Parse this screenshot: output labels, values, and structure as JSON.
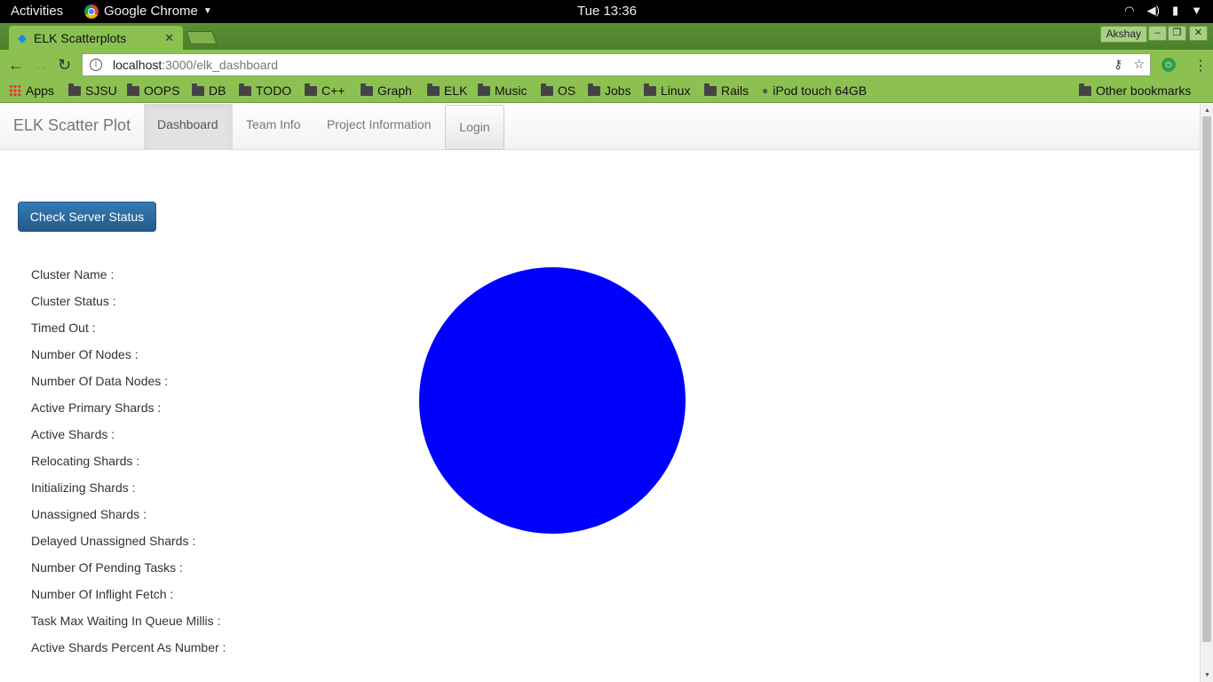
{
  "os_bar": {
    "activities": "Activities",
    "app_name": "Google Chrome",
    "clock": "Tue 13:36"
  },
  "browser": {
    "tab_title": "ELK Scatterplots",
    "user_name": "Akshay",
    "url_host": "localhost",
    "url_path": ":3000/elk_dashboard",
    "bookmarks": [
      "Apps",
      "SJSU",
      "OOPS",
      "DB",
      "TODO",
      "C++",
      "Graph",
      "ELK",
      "Music",
      "OS",
      "Jobs",
      "Linux",
      "Rails",
      "iPod touch 64GB"
    ],
    "other_bookmarks": "Other bookmarks",
    "theme_color": "#8cc152"
  },
  "navbar": {
    "brand": "ELK Scatter Plot",
    "items": [
      {
        "label": "Dashboard",
        "active": true
      },
      {
        "label": "Team Info",
        "active": false
      },
      {
        "label": "Project Information",
        "active": false
      }
    ],
    "login": "Login"
  },
  "main": {
    "check_button": "Check Server Status",
    "stats": [
      "Cluster Name :",
      "Cluster Status :",
      "Timed Out :",
      "Number Of Nodes :",
      "Number Of Data Nodes :",
      "Active Primary Shards :",
      "Active Shards :",
      "Relocating Shards :",
      "Initializing Shards :",
      "Unassigned Shards :",
      "Delayed Unassigned Shards :",
      "Number Of Pending Tasks :",
      "Number Of Inflight Fetch :",
      "Task Max Waiting In Queue Millis :",
      "Active Shards Percent As Number :"
    ],
    "circle_color": "#0000ff"
  }
}
